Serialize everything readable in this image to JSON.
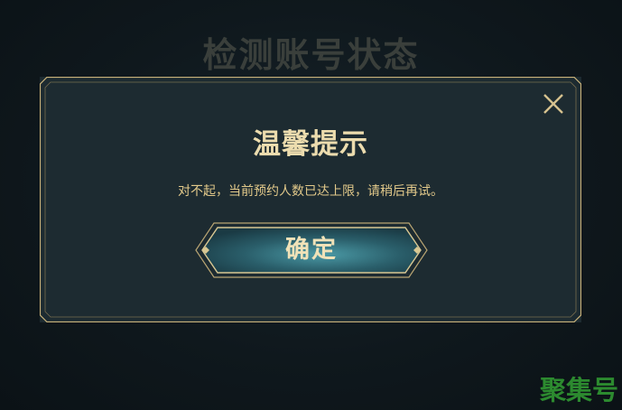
{
  "background": {
    "title": "检测账号状态"
  },
  "dialog": {
    "title": "温馨提示",
    "message": "对不起，当前预约人数已达上限，请稍后再试。",
    "confirm_label": "确定",
    "close_icon": "close-icon"
  },
  "watermark": "聚集号",
  "colors": {
    "gold": "#c9b27a",
    "title_text": "#ecdcae",
    "message_text": "#e2c98a",
    "panel": "#1d2b31",
    "button_teal": "#2f6f7d"
  }
}
